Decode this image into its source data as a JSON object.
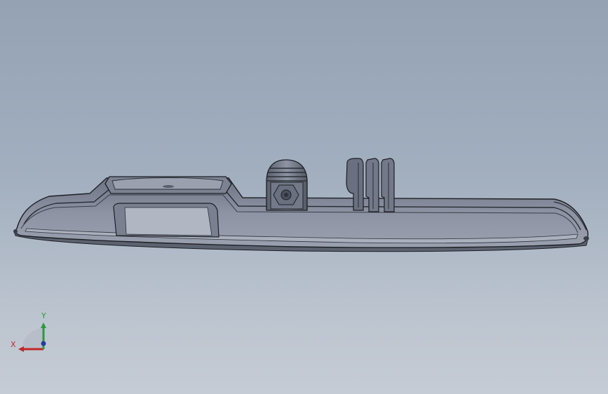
{
  "scene": {
    "background_top": "#94a2b4",
    "background_bottom": "#c5ccd5",
    "part_fill": "#8b91a1",
    "part_dark": "#4a4f5c",
    "part_edge": "#1d1f25"
  },
  "triad": {
    "x_label": "X",
    "y_label": "Y",
    "x_color": "#c0282a",
    "y_color": "#2a9a3a",
    "z_color": "#2a3a9a"
  }
}
